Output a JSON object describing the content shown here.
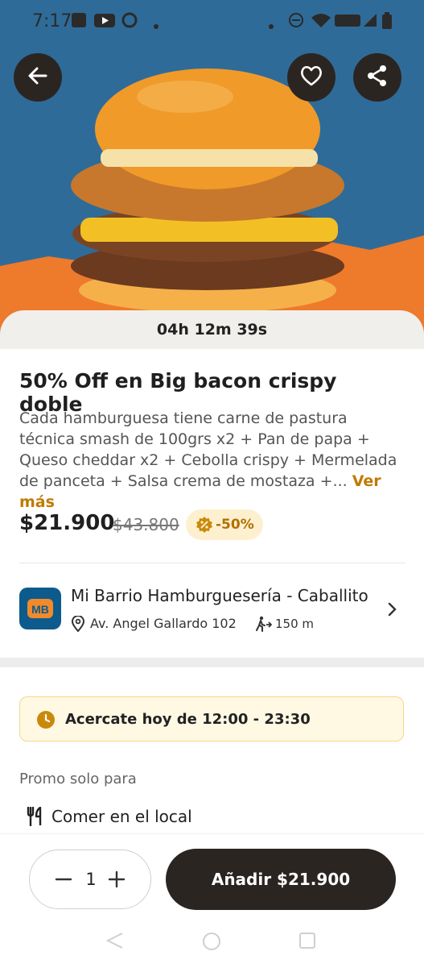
{
  "status_bar": {
    "time": "7:17"
  },
  "timer": "04h 12m 39s",
  "offer": {
    "title": "50% Off en Big bacon crispy doble",
    "description": "Cada hamburguesa tiene carne de pastura técnica smash de 100grs x2 + Pan de papa + Queso cheddar x2 + Cebolla crispy + Mermelada de panceta + Salsa crema de mostaza +...",
    "see_more": "Ver más",
    "price": "$21.900",
    "old_price": "$43.800",
    "discount_badge": "-50%"
  },
  "store": {
    "logo_text": "MB",
    "name": "Mi Barrio Hamburguesería - Caballito",
    "address": "Av. Angel Gallardo 102",
    "distance": "150 m"
  },
  "hours": {
    "text": "Acercate hoy de 12:00 - 23:30"
  },
  "promo": {
    "label": "Promo solo para",
    "option": "Comer en el local"
  },
  "cart": {
    "quantity": "1",
    "add_label": "Añadir $21.900"
  },
  "colors": {
    "accent": "#c07a00",
    "dark": "#2b2522",
    "hero_blue": "#2f6b98",
    "hero_orange": "#ee7a2c"
  },
  "icons": [
    "back-arrow-icon",
    "heart-icon",
    "share-icon",
    "clock-icon",
    "location-pin-icon",
    "walking-icon",
    "chevron-right-icon",
    "cutlery-icon",
    "discount-seal-icon",
    "minus-icon",
    "plus-icon"
  ]
}
